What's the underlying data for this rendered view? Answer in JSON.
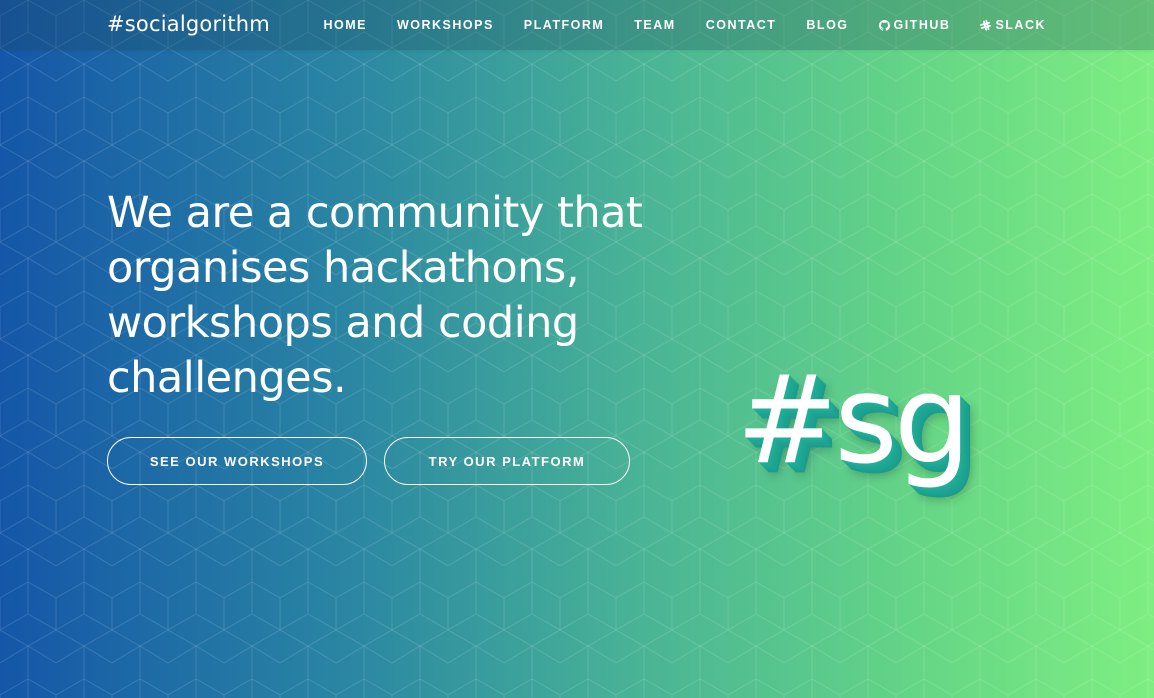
{
  "brand": {
    "title": "#socialgorithm"
  },
  "nav": {
    "items": [
      {
        "label": "HOME"
      },
      {
        "label": "WORKSHOPS"
      },
      {
        "label": "PLATFORM"
      },
      {
        "label": "TEAM"
      },
      {
        "label": "CONTACT"
      },
      {
        "label": "BLOG"
      },
      {
        "label": "GITHUB",
        "icon": "github-icon"
      },
      {
        "label": "SLACK",
        "icon": "slack-icon"
      }
    ]
  },
  "hero": {
    "headline": "We are a community that organises hackathons, workshops and coding challenges.",
    "buttons": {
      "workshops_label": "SEE OUR WORKSHOPS",
      "platform_label": "TRY OUR PLATFORM"
    },
    "logo_mark": "#sg"
  },
  "colors": {
    "gradient_start": "#1556a8",
    "gradient_end": "#7eee82",
    "logo_shadow": "#1fae96",
    "text": "#ffffff"
  }
}
